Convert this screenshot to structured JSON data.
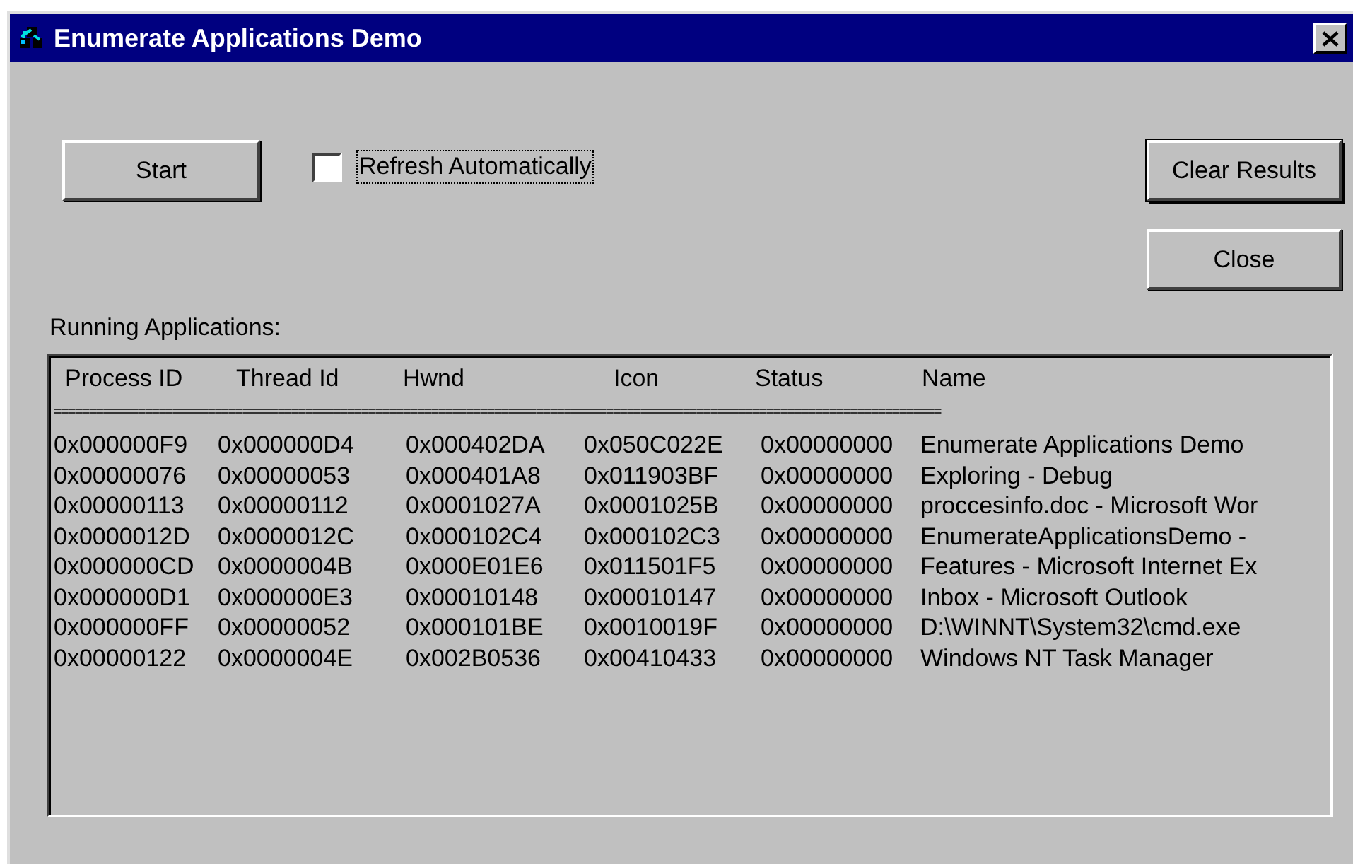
{
  "window": {
    "title": "Enumerate Applications Demo"
  },
  "buttons": [
    {
      "label": "Start",
      "default": false
    },
    {
      "label": "Clear Results",
      "default": true
    },
    {
      "label": "Close",
      "default": false
    }
  ],
  "refresh_checkbox": {
    "label": "Refresh Automatically",
    "checked": false,
    "focused": true
  },
  "list_label": "Running Applications:",
  "list": {
    "columns": [
      "Process ID",
      "Thread Id",
      "Hwnd",
      "Icon",
      "Status",
      "Name"
    ],
    "separator": "===============================================================================================================================",
    "rows": [
      [
        "0x000000F9",
        "0x000000D4",
        "0x000402DA",
        "0x050C022E",
        "0x00000000",
        "Enumerate Applications Demo"
      ],
      [
        "0x00000076",
        "0x00000053",
        "0x000401A8",
        "0x011903BF",
        "0x00000000",
        "Exploring - Debug"
      ],
      [
        "0x00000113",
        "0x00000112",
        "0x0001027A",
        "0x0001025B",
        "0x00000000",
        "proccesinfo.doc - Microsoft Wor"
      ],
      [
        "0x0000012D",
        "0x0000012C",
        "0x000102C4",
        "0x000102C3",
        "0x00000000",
        "EnumerateApplicationsDemo -"
      ],
      [
        "0x000000CD",
        "0x0000004B",
        "0x000E01E6",
        "0x011501F5",
        "0x00000000",
        "Features - Microsoft Internet Ex"
      ],
      [
        "0x000000D1",
        "0x000000E3",
        "0x00010148",
        "0x00010147",
        "0x00000000",
        "Inbox - Microsoft Outlook"
      ],
      [
        "0x000000FF",
        "0x00000052",
        "0x000101BE",
        "0x0010019F",
        "0x00000000",
        "D:\\WINNT\\System32\\cmd.exe"
      ],
      [
        "0x00000122",
        "0x0000004E",
        "0x002B0536",
        "0x00410433",
        "0x00000000",
        "Windows NT Task Manager"
      ]
    ]
  }
}
